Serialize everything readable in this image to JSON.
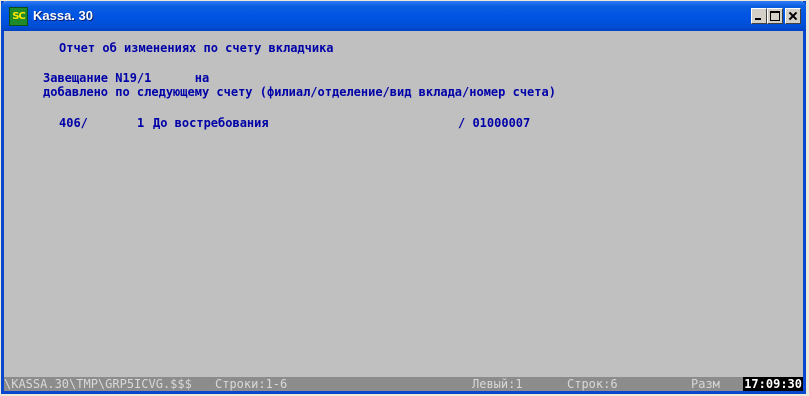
{
  "window": {
    "title": "Kassa. 30",
    "icon_text": "SC"
  },
  "console": {
    "heading": "Отчет об изменениях по счету вкладчика",
    "will_line": "Завещание N19/1      на",
    "desc_line": "добавлено по следующему счету (филиал/отделение/вид вклада/номер счета)",
    "account": {
      "branch": "406/",
      "dept": "1",
      "deposit_type": "До востребования",
      "account_number": "/ 01000007"
    }
  },
  "statusbar": {
    "path": "\\KASSA.30\\TMP\\GRP5ICVG.$$$",
    "rows_range": "Строки:1-6",
    "left": "Левый:1",
    "rows_count": "Строк:6",
    "size_label": "Разм",
    "clock": "17:09:30"
  },
  "icons": {
    "app": "kassa-app-icon",
    "minimize": "minimize-icon",
    "maximize": "maximize-icon",
    "close": "close-icon"
  },
  "colors": {
    "title_bar": "#0054e3",
    "console_bg": "#c0c0c0",
    "console_text": "#0000a8",
    "status_bg": "#8c8c8c",
    "clock_bg": "#000000"
  }
}
